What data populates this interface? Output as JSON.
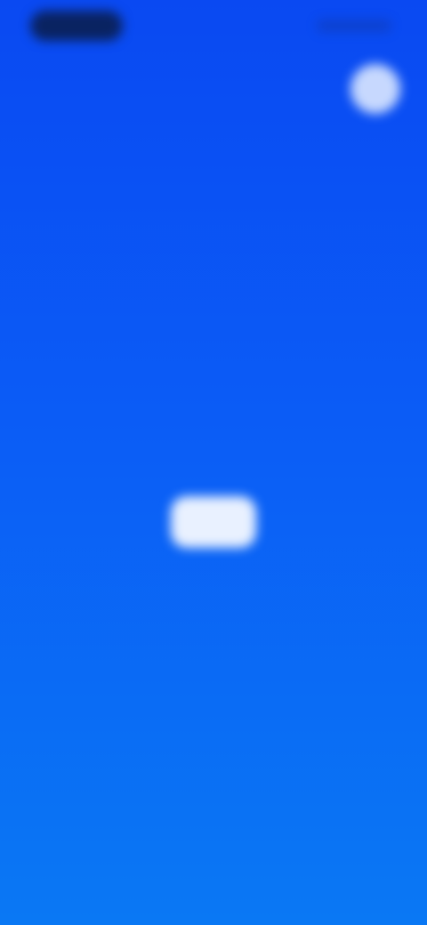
{
  "header": {
    "status_pill": "",
    "close_icon": "close-icon"
  },
  "message": {
    "title": "",
    "body": ""
  },
  "action": {
    "label": ""
  },
  "colors": {
    "background_top": "#0a49f2",
    "background_bottom": "#0a78f4",
    "button_bg": "#e9f1ff"
  }
}
